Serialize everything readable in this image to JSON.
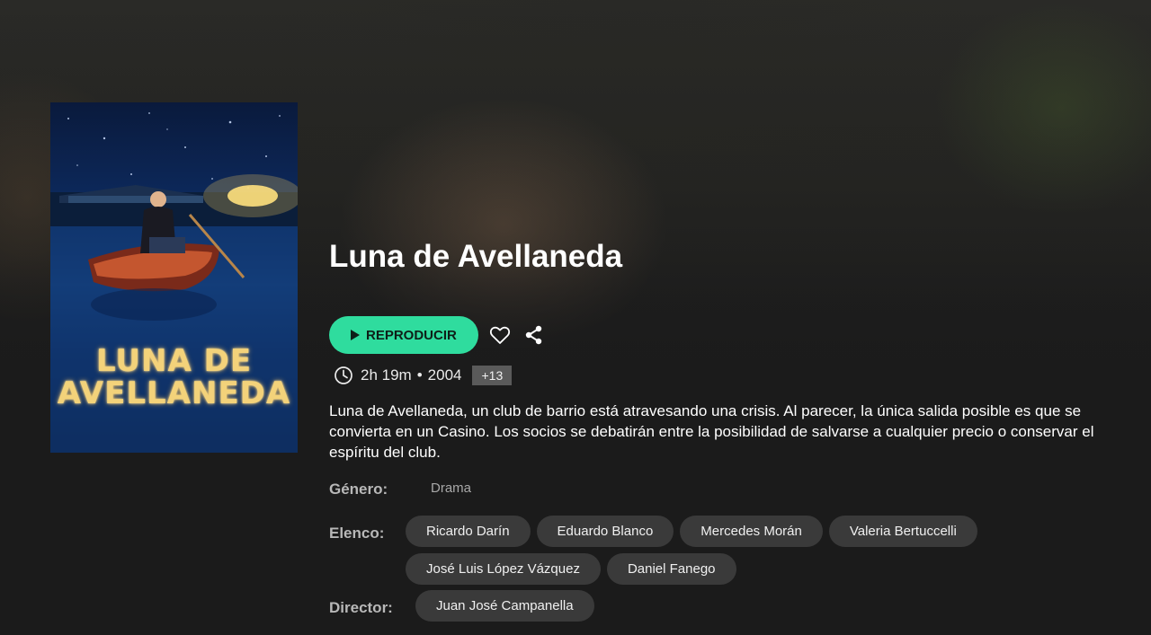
{
  "poster": {
    "title_text": "LUNA DE\nAVELLANEDA"
  },
  "movie": {
    "title": "Luna de Avellaneda",
    "duration": "2h 19m",
    "year": "2004",
    "separator": "•",
    "rating": "+13",
    "synopsis": "Luna de Avellaneda, un club de barrio está atravesando una crisis. Al parecer, la única salida posible es que se convierta en un Casino. Los socios se debatirán entre la posibilidad de salvarse a cualquier precio o conservar el espíritu del club."
  },
  "actions": {
    "play_label": "REPRODUCIR",
    "favorite_icon": "heart-icon",
    "share_icon": "share-icon"
  },
  "details": {
    "genre_label": "Género:",
    "genre_value": "Drama",
    "cast_label": "Elenco:",
    "cast": [
      "Ricardo Darín",
      "Eduardo Blanco",
      "Mercedes Morán",
      "Valeria Bertuccelli",
      "José Luis López Vázquez",
      "Daniel Fanego"
    ],
    "director_label": "Director:",
    "directors": [
      "Juan José Campanella"
    ]
  },
  "colors": {
    "accent": "#2fdc9e",
    "background": "#1b1b1b",
    "chip": "#3a3a3a"
  }
}
